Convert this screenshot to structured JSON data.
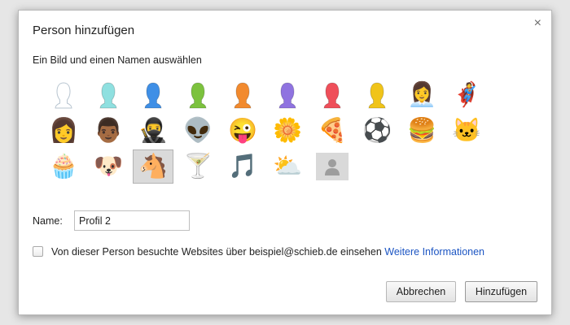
{
  "dialog": {
    "title": "Person hinzufügen",
    "close_glyph": "×",
    "subtitle": "Ein Bild und einen Namen auswählen"
  },
  "avatars": [
    {
      "name": "avatar-generic-white",
      "color": "#ffffff"
    },
    {
      "name": "avatar-generic-cyan",
      "color": "#8fe0e0"
    },
    {
      "name": "avatar-generic-blue",
      "color": "#3f8fe6"
    },
    {
      "name": "avatar-generic-green",
      "color": "#7cc23e"
    },
    {
      "name": "avatar-generic-orange",
      "color": "#f28a2e"
    },
    {
      "name": "avatar-generic-purple",
      "color": "#8f73e0"
    },
    {
      "name": "avatar-generic-red",
      "color": "#ef4f5a"
    },
    {
      "name": "avatar-generic-yellow",
      "color": "#f0c419"
    },
    {
      "name": "avatar-businesswoman",
      "glyph": "👩‍💼"
    },
    {
      "name": "avatar-superhero",
      "glyph": "🦸"
    },
    {
      "name": "avatar-woman-sunglasses",
      "glyph": "👩"
    },
    {
      "name": "avatar-man",
      "glyph": "👨🏾"
    },
    {
      "name": "avatar-ninja",
      "glyph": "🥷"
    },
    {
      "name": "avatar-alien",
      "glyph": "👽"
    },
    {
      "name": "avatar-smiley",
      "glyph": "😜"
    },
    {
      "name": "avatar-flower",
      "glyph": "🌼"
    },
    {
      "name": "avatar-pizza",
      "glyph": "🍕"
    },
    {
      "name": "avatar-soccer-ball",
      "glyph": "⚽"
    },
    {
      "name": "avatar-burger",
      "glyph": "🍔"
    },
    {
      "name": "avatar-cat",
      "glyph": "🐱"
    },
    {
      "name": "avatar-cupcake",
      "glyph": "🧁"
    },
    {
      "name": "avatar-dog",
      "glyph": "🐶"
    },
    {
      "name": "avatar-horse",
      "glyph": "🐴",
      "selected": true
    },
    {
      "name": "avatar-cocktail",
      "glyph": "🍸"
    },
    {
      "name": "avatar-music-note",
      "glyph": "🎵"
    },
    {
      "name": "avatar-sun-cloud",
      "glyph": "⛅"
    },
    {
      "name": "avatar-placeholder-silhouette",
      "placeholder": true
    }
  ],
  "name_field": {
    "label": "Name:",
    "value": "Profil 2"
  },
  "supervision": {
    "text": "Von dieser Person besuchte Websites über beispiel@schieb.de einsehen",
    "link": "Weitere Informationen",
    "checked": false
  },
  "buttons": {
    "cancel": "Abbrechen",
    "add": "Hinzufügen"
  }
}
